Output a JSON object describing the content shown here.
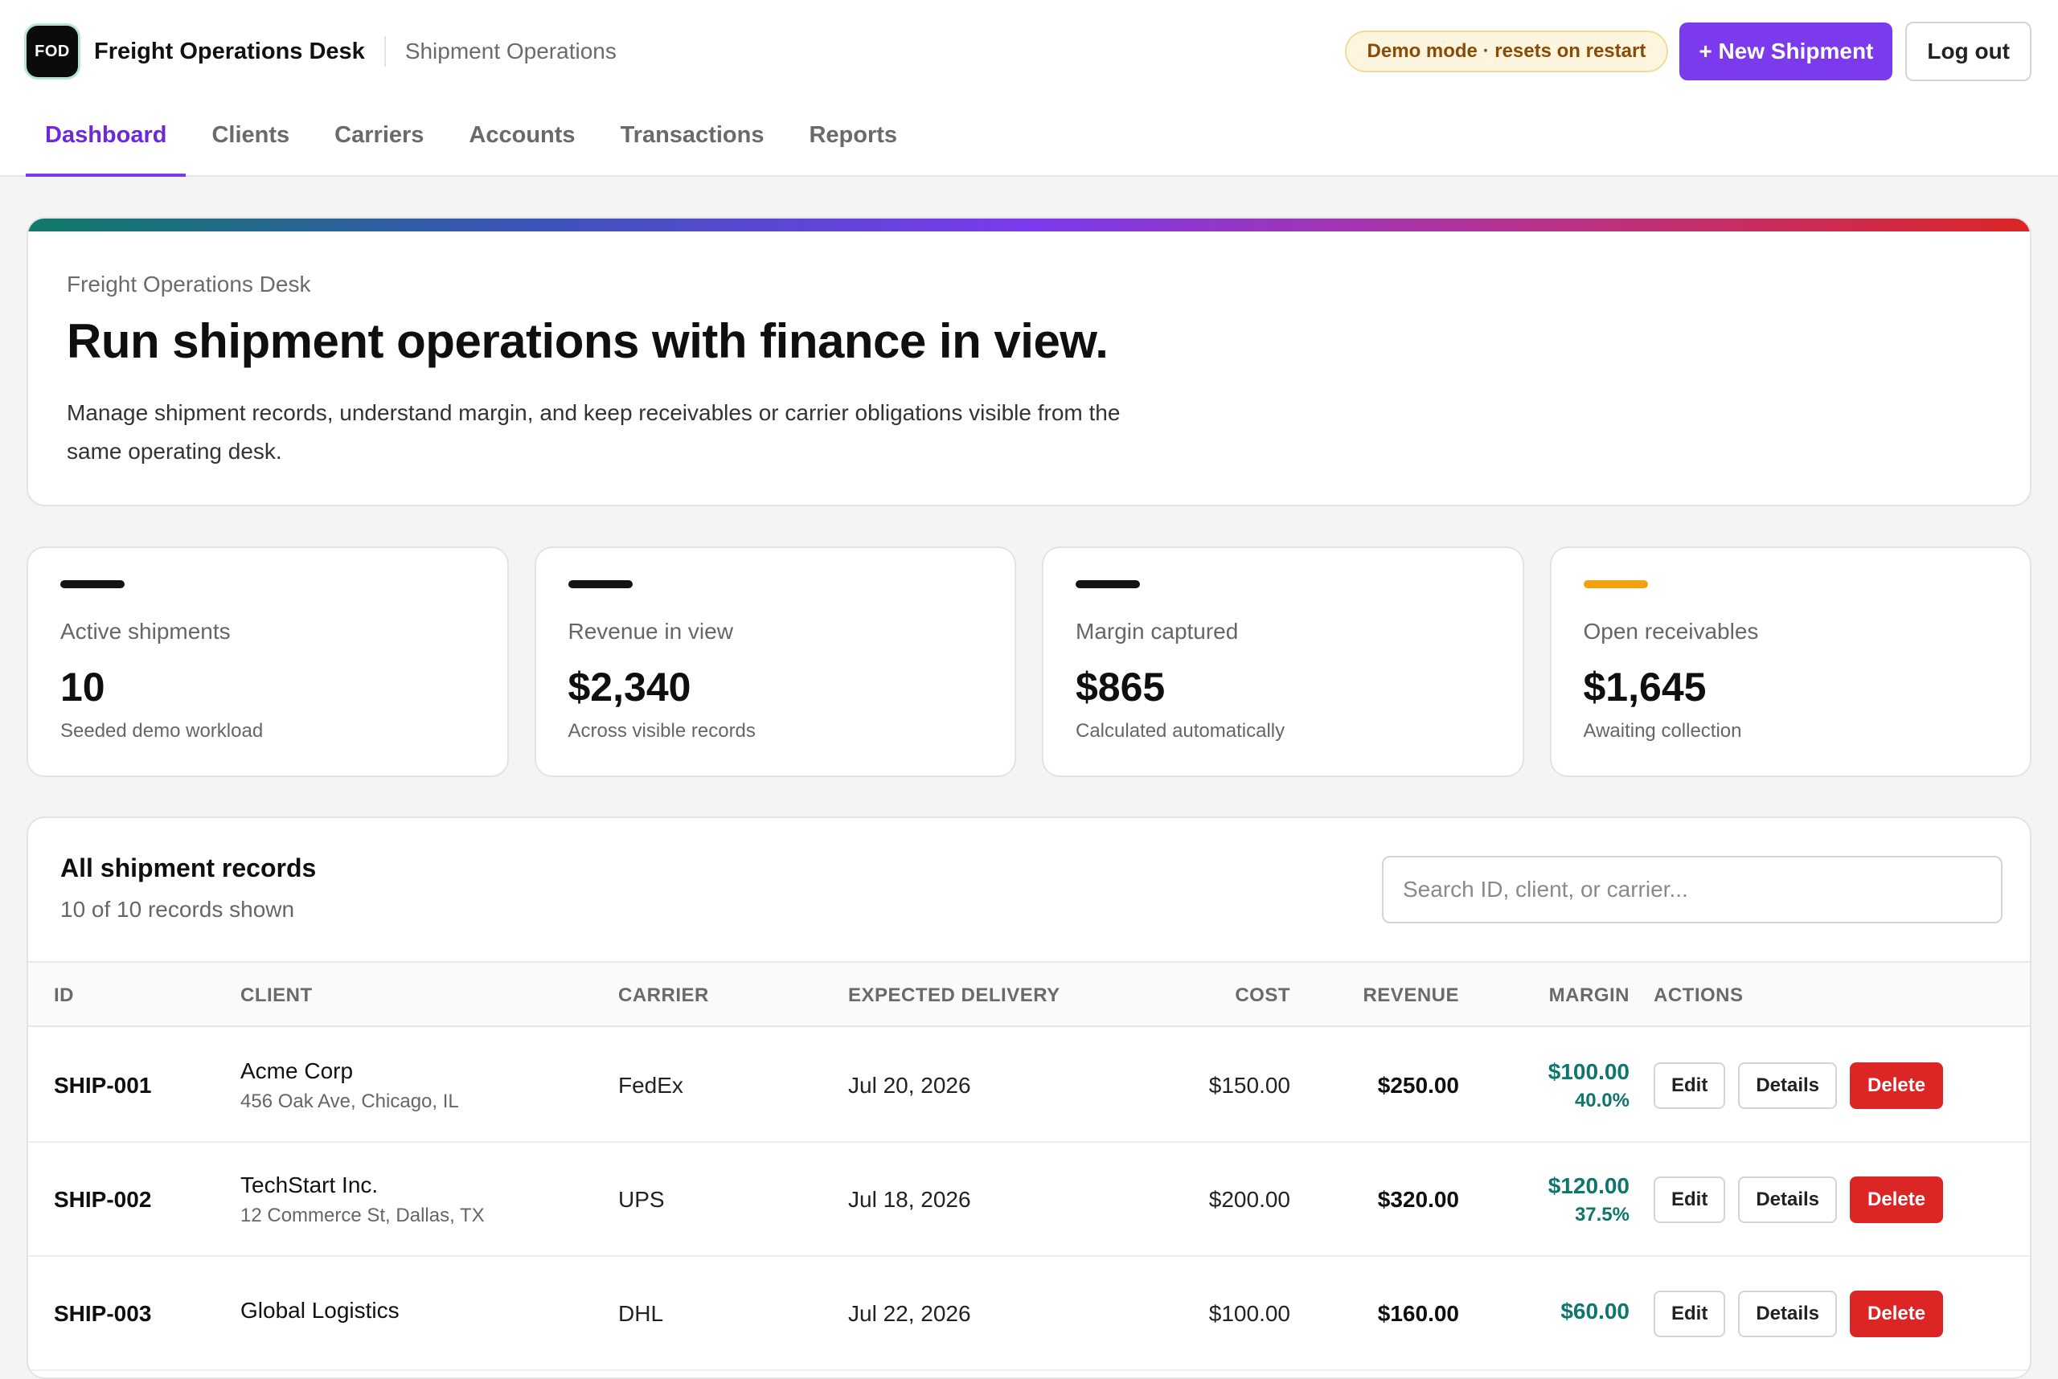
{
  "header": {
    "logo_text": "FOD",
    "app_name": "Freight Operations Desk",
    "section": "Shipment Operations",
    "demo_badge": "Demo mode · resets on restart",
    "new_button": "+ New Shipment",
    "logout_button": "Log out"
  },
  "nav": {
    "tabs": [
      "Dashboard",
      "Clients",
      "Carriers",
      "Accounts",
      "Transactions",
      "Reports"
    ],
    "active": "Dashboard"
  },
  "hero": {
    "eyebrow": "Freight Operations Desk",
    "title": "Run shipment operations with finance in view.",
    "description": "Manage shipment records, understand margin, and keep receivables or carrier obligations visible from the same operating desk."
  },
  "stats": [
    {
      "label": "Active shipments",
      "value": "10",
      "note": "Seeded demo workload",
      "accent": "#141414"
    },
    {
      "label": "Revenue in view",
      "value": "$2,340",
      "note": "Across visible records",
      "accent": "#141414"
    },
    {
      "label": "Margin captured",
      "value": "$865",
      "note": "Calculated automatically",
      "accent": "#141414"
    },
    {
      "label": "Open receivables",
      "value": "$1,645",
      "note": "Awaiting collection",
      "accent": "#f2a20f"
    }
  ],
  "records": {
    "title": "All shipment records",
    "count_text": "10 of 10 records shown",
    "search_placeholder": "Search ID, client, or carrier...",
    "columns": [
      "ID",
      "CLIENT",
      "CARRIER",
      "EXPECTED DELIVERY",
      "COST",
      "REVENUE",
      "MARGIN",
      "ACTIONS"
    ],
    "action_labels": {
      "edit": "Edit",
      "details": "Details",
      "delete": "Delete"
    },
    "rows": [
      {
        "id": "SHIP-001",
        "client": "Acme Corp",
        "address": "456 Oak Ave, Chicago, IL",
        "carrier": "FedEx",
        "delivery": "Jul 20, 2026",
        "cost": "$150.00",
        "revenue": "$250.00",
        "margin": "$100.00",
        "margin_pct": "40.0%"
      },
      {
        "id": "SHIP-002",
        "client": "TechStart Inc.",
        "address": "12 Commerce St, Dallas, TX",
        "carrier": "UPS",
        "delivery": "Jul 18, 2026",
        "cost": "$200.00",
        "revenue": "$320.00",
        "margin": "$120.00",
        "margin_pct": "37.5%"
      },
      {
        "id": "SHIP-003",
        "client": "Global Logistics",
        "address": "",
        "carrier": "DHL",
        "delivery": "Jul 22, 2026",
        "cost": "$100.00",
        "revenue": "$160.00",
        "margin": "$60.00",
        "margin_pct": ""
      }
    ]
  },
  "colors": {
    "accent": "#7c3aed",
    "margin_positive": "#0f766e",
    "danger": "#dc2626"
  }
}
